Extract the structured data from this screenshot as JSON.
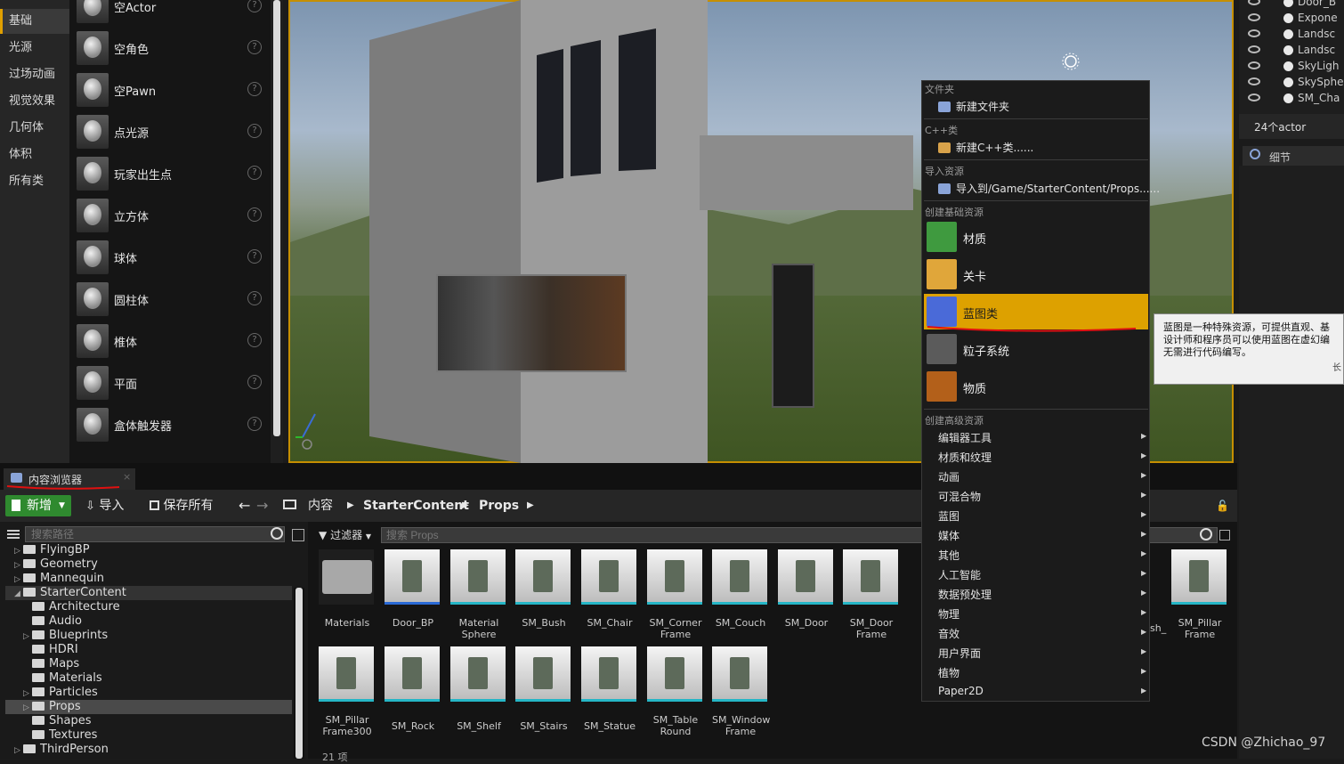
{
  "categories": [
    "基础",
    "光源",
    "过场动画",
    "视觉效果",
    "几何体",
    "体积",
    "所有类"
  ],
  "actors": [
    "空Actor",
    "空角色",
    "空Pawn",
    "点光源",
    "玩家出生点",
    "立方体",
    "球体",
    "圆柱体",
    "椎体",
    "平面",
    "盒体触发器"
  ],
  "outliner": {
    "rows": [
      "Door_B",
      "Expone",
      "Landsc",
      "Landsc",
      "SkyLigh",
      "SkySphe",
      "SM_Cha"
    ],
    "count": "24个actor",
    "details_tab": "细节"
  },
  "content_browser": {
    "tab": "内容浏览器",
    "toolbar": {
      "new": "新增",
      "import": "导入",
      "save_all": "保存所有"
    },
    "breadcrumb": [
      "内容",
      "StarterContent",
      "Props"
    ],
    "path_search_placeholder": "搜索路径",
    "filter": "过滤器",
    "asset_search_placeholder": "搜索 Props",
    "tree": [
      {
        "label": "FlyingBP",
        "level": 1,
        "expandable": true
      },
      {
        "label": "Geometry",
        "level": 1,
        "expandable": true
      },
      {
        "label": "Mannequin",
        "level": 1,
        "expandable": true
      },
      {
        "label": "StarterContent",
        "level": 1,
        "expandable": true,
        "open": true
      },
      {
        "label": "Architecture",
        "level": 2,
        "expandable": false
      },
      {
        "label": "Audio",
        "level": 2,
        "expandable": false
      },
      {
        "label": "Blueprints",
        "level": 2,
        "expandable": true
      },
      {
        "label": "HDRI",
        "level": 2,
        "expandable": false
      },
      {
        "label": "Maps",
        "level": 2,
        "expandable": false
      },
      {
        "label": "Materials",
        "level": 2,
        "expandable": false
      },
      {
        "label": "Particles",
        "level": 2,
        "expandable": true
      },
      {
        "label": "Props",
        "level": 2,
        "expandable": true,
        "selected": true
      },
      {
        "label": "Shapes",
        "level": 2,
        "expandable": false
      },
      {
        "label": "Textures",
        "level": 2,
        "expandable": false
      },
      {
        "label": "ThirdPerson",
        "level": 1,
        "expandable": true
      }
    ],
    "assets_row1": [
      "Materials",
      "Door_BP",
      "Material Sphere",
      "SM_Bush",
      "SM_Chair",
      "SM_Corner Frame",
      "SM_Couch",
      "SM_Door",
      "SM_Door Frame",
      "SM_Pillar Frame"
    ],
    "assets_row2": [
      "SM_Pillar Frame300",
      "SM_Rock",
      "SM_Shelf",
      "SM_Stairs",
      "SM_Statue",
      "SM_Table Round",
      "SM_Window Frame"
    ],
    "partial_right_label": "sh_",
    "item_count": "21 项"
  },
  "context_menu": {
    "sections": {
      "folder": "文件夹",
      "cpp": "C++类",
      "import": "导入资源",
      "basic": "创建基础资源",
      "advanced": "创建高级资源"
    },
    "new_folder": "新建文件夹",
    "new_cpp": "新建C++类......",
    "import_to": "导入到/Game/StarterContent/Props......",
    "basic_assets": [
      "材质",
      "关卡",
      "蓝图类",
      "粒子系统",
      "物质"
    ],
    "advanced_assets": [
      "编辑器工具",
      "材质和纹理",
      "动画",
      "可混合物",
      "蓝图",
      "媒体",
      "其他",
      "人工智能",
      "数据预处理",
      "物理",
      "音效",
      "用户界面",
      "植物",
      "Paper2D"
    ]
  },
  "tooltip": {
    "line1": "蓝图是一种特殊资源，可提供直观、基",
    "line2": "设计师和程序员可以使用蓝图在虚幻编",
    "line3": "无需进行代码编写。",
    "more": "长"
  },
  "watermark": "CSDN @Zhichao_97",
  "colors": {
    "accent": "#dda100",
    "new_button": "#2f8a2f",
    "selection": "#3a3a3a"
  }
}
